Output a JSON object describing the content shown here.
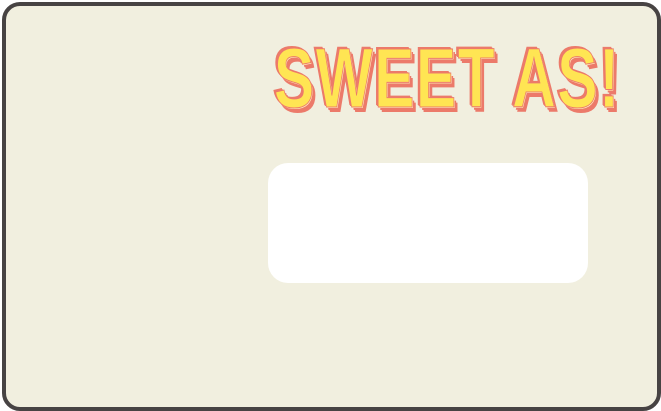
{
  "card": {
    "headline": "SWEET AS!"
  },
  "colors": {
    "background": "#f1efdf",
    "border": "#474343",
    "headline_fill": "#ffe553",
    "headline_shadow": "#ec7a6a",
    "panel": "#ffffff"
  }
}
